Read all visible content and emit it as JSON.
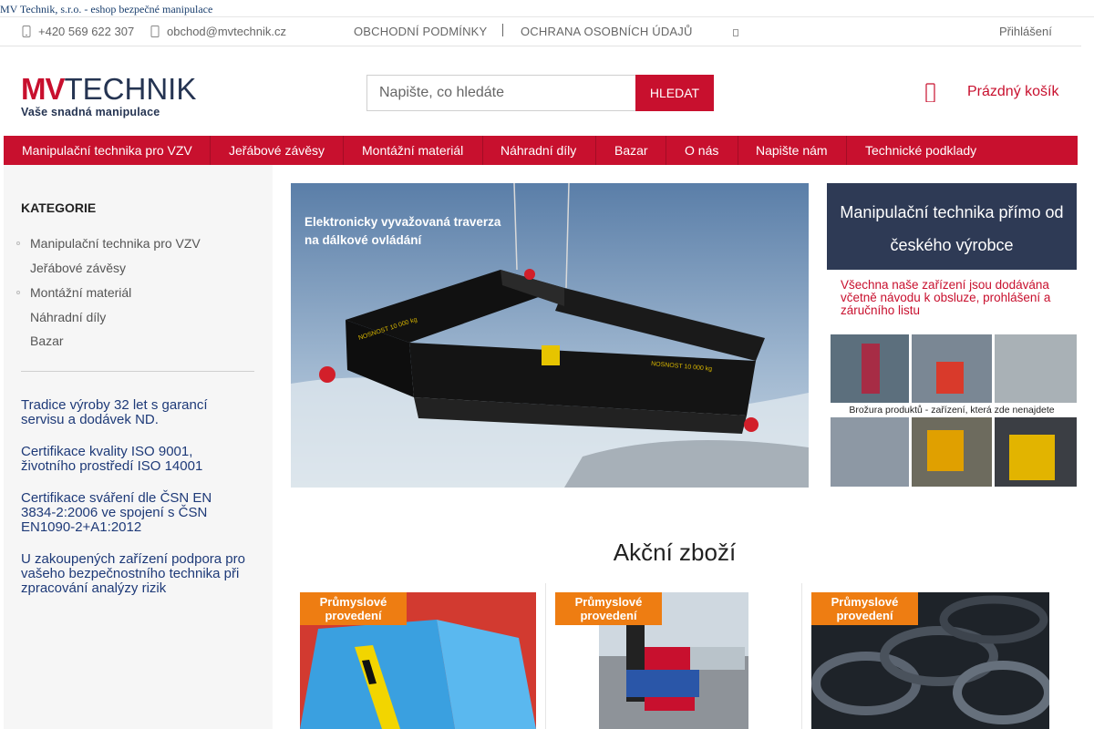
{
  "window": {
    "title": "MV Technik, s.r.o. - eshop bezpečné manipulace"
  },
  "topbar": {
    "phone": "+420 569 622 307",
    "email": "obchod@mvtechnik.cz",
    "links": [
      "OBCHODNÍ PODMÍNKY",
      "OCHRANA OSOBNÍCH ÚDAJŮ"
    ],
    "login": "Přihlášení"
  },
  "header": {
    "logo_mv": "MV",
    "logo_technik": "TECHNIK",
    "logo_tagline": "Vaše snadná manipulace",
    "search_placeholder": "Napište, co hledáte",
    "search_button": "HLEDAT",
    "cart_label": "Prázdný košík"
  },
  "nav": {
    "items": [
      "Manipulační technika pro VZV",
      "Jeřábové závěsy",
      "Montážní materiál",
      "Náhradní díly",
      "Bazar",
      "O nás",
      "Napište nám",
      "Technické podklady"
    ]
  },
  "sidebar": {
    "title": "KATEGORIE",
    "categories": [
      "Manipulační technika pro VZV",
      "Jeřábové závěsy",
      "Montážní materiál",
      "Náhradní díly",
      "Bazar"
    ],
    "benefits": [
      "Tradice výroby 32 let s garancí servisu a dodávek ND.",
      "Certifikace kvality ISO 9001, životního prostředí ISO 14001",
      "Certifikace sváření dle ČSN EN 3834-2:2006 ve spojení s ČSN EN1090-2+A1:2012",
      "U zakoupených zařízení podpora pro vašeho bezpečnostního technika při zpracování analýzy rizik"
    ]
  },
  "banner": {
    "caption_line1": "Elektronicky vyvažovaná traverza",
    "caption_line2": "na dálkové ovládání",
    "beam_label": "NOSNOST 10 000 kg"
  },
  "promo": {
    "box_text": "Manipulační technika přímo od českého výrobce",
    "note": "Všechna naše zařízení jsou dodávána včetně návodu k obsluze, prohlášení a záručního listu",
    "brochure_caption": "Brožura produktů - zařízení, která zde nenajdete"
  },
  "products": {
    "section_title": "Akční zboží",
    "badge": "Průmyslové provedení"
  },
  "colors": {
    "brand_red": "#c8102e",
    "navy": "#2e3a55",
    "badge_orange": "#ee7d12"
  }
}
